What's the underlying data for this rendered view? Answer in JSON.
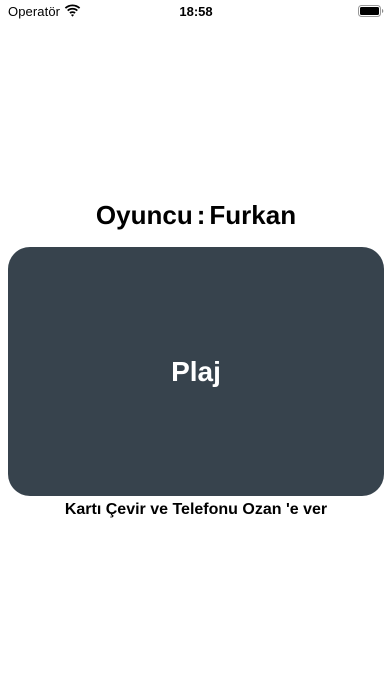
{
  "status_bar": {
    "carrier": "Operatör",
    "time": "18:58",
    "icons": [
      "wifi-icon",
      "battery-icon"
    ]
  },
  "player": {
    "label": "Oyuncu",
    "separator": ":",
    "name": "Furkan"
  },
  "card": {
    "word": "Plaj",
    "color": "#37434d"
  },
  "instruction": {
    "prefix": "Kartı Çevir ve Telefonu",
    "next_player": "Ozan",
    "suffix": "'e ver"
  }
}
